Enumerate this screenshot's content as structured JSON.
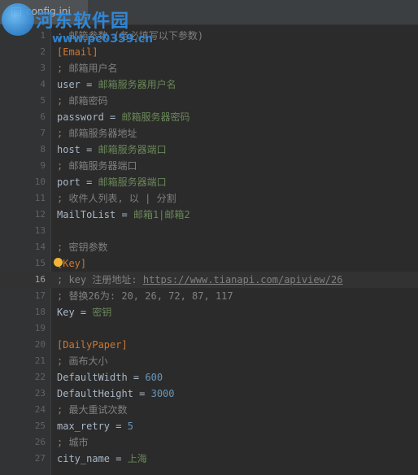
{
  "tab": {
    "label": "config.ini",
    "icon": "text-file-icon"
  },
  "watermark": {
    "text": "河东软件园",
    "url": "www.pc0359.cn",
    "icon": "logo-icon"
  },
  "colors": {
    "background": "#2b2b2b",
    "comment": "#808080",
    "section": "#cc7832",
    "value": "#6a8759",
    "number": "#6897bb"
  },
  "current_line": 16,
  "lines": [
    {
      "n": "1",
      "parts": [
        {
          "t": "comment",
          "v": "; 邮箱参数 (务必填写以下参数)"
        }
      ]
    },
    {
      "n": "2",
      "parts": [
        {
          "t": "section",
          "v": "[Email]"
        }
      ]
    },
    {
      "n": "3",
      "parts": [
        {
          "t": "comment",
          "v": "; 邮箱用户名"
        }
      ]
    },
    {
      "n": "4",
      "parts": [
        {
          "t": "key",
          "v": "user"
        },
        {
          "t": "eq",
          "v": " = "
        },
        {
          "t": "val",
          "v": "邮箱服务器用户名"
        }
      ]
    },
    {
      "n": "5",
      "parts": [
        {
          "t": "comment",
          "v": "; 邮箱密码"
        }
      ]
    },
    {
      "n": "6",
      "parts": [
        {
          "t": "key",
          "v": "password"
        },
        {
          "t": "eq",
          "v": " = "
        },
        {
          "t": "val",
          "v": "邮箱服务器密码"
        }
      ]
    },
    {
      "n": "7",
      "parts": [
        {
          "t": "comment",
          "v": "; 邮箱服务器地址"
        }
      ]
    },
    {
      "n": "8",
      "parts": [
        {
          "t": "key",
          "v": "host"
        },
        {
          "t": "eq",
          "v": " = "
        },
        {
          "t": "val",
          "v": "邮箱服务器端口"
        }
      ]
    },
    {
      "n": "9",
      "parts": [
        {
          "t": "comment",
          "v": "; 邮箱服务器端口"
        }
      ]
    },
    {
      "n": "10",
      "parts": [
        {
          "t": "key",
          "v": "port"
        },
        {
          "t": "eq",
          "v": " = "
        },
        {
          "t": "val",
          "v": "邮箱服务器端口"
        }
      ]
    },
    {
      "n": "11",
      "parts": [
        {
          "t": "comment",
          "v": "; 收件人列表, 以 | 分割"
        }
      ]
    },
    {
      "n": "12",
      "parts": [
        {
          "t": "key",
          "v": "MailToList"
        },
        {
          "t": "eq",
          "v": " = "
        },
        {
          "t": "val",
          "v": "邮箱1|邮箱2"
        }
      ]
    },
    {
      "n": "13",
      "parts": []
    },
    {
      "n": "14",
      "parts": [
        {
          "t": "comment",
          "v": "; 密钥参数"
        }
      ]
    },
    {
      "n": "15",
      "parts": [
        {
          "t": "section",
          "v": "[Key]"
        }
      ]
    },
    {
      "n": "16",
      "parts": [
        {
          "t": "comment",
          "v": "; key 注册地址: "
        },
        {
          "t": "link",
          "v": "https://www.tianapi.com/apiview/26"
        }
      ]
    },
    {
      "n": "17",
      "parts": [
        {
          "t": "comment",
          "v": "; 替换26为: 20, 26, 72, 87, 117"
        }
      ]
    },
    {
      "n": "18",
      "parts": [
        {
          "t": "key",
          "v": "Key"
        },
        {
          "t": "eq",
          "v": " = "
        },
        {
          "t": "val",
          "v": "密钥"
        }
      ]
    },
    {
      "n": "19",
      "parts": []
    },
    {
      "n": "20",
      "parts": [
        {
          "t": "section",
          "v": "[DailyPaper]"
        }
      ]
    },
    {
      "n": "21",
      "parts": [
        {
          "t": "comment",
          "v": "; 画布大小"
        }
      ]
    },
    {
      "n": "22",
      "parts": [
        {
          "t": "key",
          "v": "DefaultWidth"
        },
        {
          "t": "eq",
          "v": " = "
        },
        {
          "t": "num",
          "v": "600"
        }
      ]
    },
    {
      "n": "23",
      "parts": [
        {
          "t": "key",
          "v": "DefaultHeight"
        },
        {
          "t": "eq",
          "v": " = "
        },
        {
          "t": "num",
          "v": "3000"
        }
      ]
    },
    {
      "n": "24",
      "parts": [
        {
          "t": "comment",
          "v": "; 最大重试次数"
        }
      ]
    },
    {
      "n": "25",
      "parts": [
        {
          "t": "key",
          "v": "max_retry"
        },
        {
          "t": "eq",
          "v": " = "
        },
        {
          "t": "num",
          "v": "5"
        }
      ]
    },
    {
      "n": "26",
      "parts": [
        {
          "t": "comment",
          "v": "; 城市"
        }
      ]
    },
    {
      "n": "27",
      "parts": [
        {
          "t": "key",
          "v": "city_name"
        },
        {
          "t": "eq",
          "v": " = "
        },
        {
          "t": "val",
          "v": "上海"
        }
      ]
    }
  ]
}
